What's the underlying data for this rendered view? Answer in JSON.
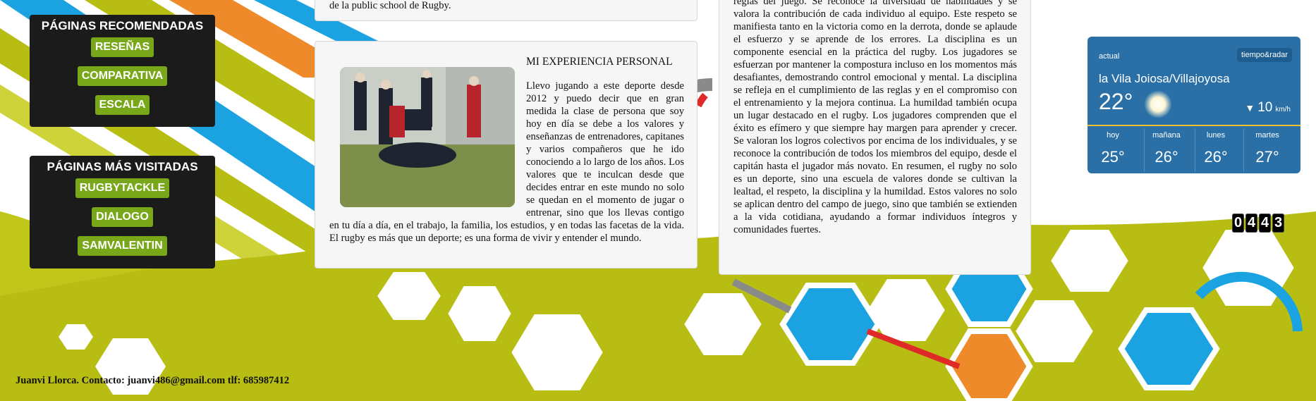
{
  "sidebar": {
    "recommended": {
      "title": "PÁGINAS RECOMENDADAS",
      "items": [
        "RESEÑAS",
        "COMPARATIVA",
        "ESCALA"
      ]
    },
    "most_visited": {
      "title": "PÁGINAS MÁS VISITADAS",
      "items": [
        "RUGBYTACKLE",
        "DIALOGO",
        "SAMVALENTIN"
      ]
    }
  },
  "top_card": {
    "text": "de la public school de Rugby."
  },
  "experience": {
    "title": "MI EXPERIENCIA PERSONAL",
    "photo_icon": "rugby-photo",
    "text": "Llevo jugando a este deporte desde 2012 y puedo decir que en gran medida la clase de persona que soy hoy en día se debe a los valores y enseñanzas de entrenadores, capitanes y varios compañeros que he ido conociendo a lo largo de los años. Los valores que te inculcan desde que decides entrar en este mundo no solo se quedan en el momento de jugar o entrenar, sino que los llevas contigo en tu día a día, en el trabajo, la familia, los estudios, y en todas las facetas de la vida. El rugby es más que un deporte; es una forma de vivir y entender el mundo."
  },
  "values": {
    "text": "reglas del juego. Se reconoce la diversidad de habilidades y se valora la contribución de cada individuo al equipo. Este respeto se manifiesta tanto en la victoria como en la derrota, donde se aplaude el esfuerzo y se aprende de los errores. La disciplina es un componente esencial en la práctica del rugby. Los jugadores se esfuerzan por mantener la compostura incluso en los momentos más desafiantes, demostrando control emocional y mental. La disciplina se refleja en el cumplimiento de las reglas y en el compromiso con el entrenamiento y la mejora continua. La humildad también ocupa un lugar destacado en el rugby. Los jugadores comprenden que el éxito es efímero y que siempre hay margen para aprender y crecer. Se valoran los logros colectivos por encima de los individuales, y se reconoce la contribución de todos los miembros del equipo, desde el capitán hasta el jugador más novato. En resumen, el rugby no solo es un deporte, sino una escuela de valores donde se cultivan la lealtad, el respeto, la disciplina y la humildad. Estos valores no solo se aplican dentro del campo de juego, sino que también se extienden a la vida cotidiana, ayudando a formar individuos íntegros y comunidades fuertes."
  },
  "weather": {
    "label": "actual",
    "brand": "tiempo&radar",
    "location": "la Vila Joiosa/Villajoyosa",
    "temp": "22°",
    "wind": "10",
    "wind_unit": "km/h",
    "forecast": [
      {
        "day": "hoy",
        "temp": "25°"
      },
      {
        "day": "mañana",
        "temp": "26°"
      },
      {
        "day": "lunes",
        "temp": "26°"
      },
      {
        "day": "martes",
        "temp": "27°"
      }
    ],
    "colors": {
      "panel": "#2a70a7",
      "accent": "#f2c230"
    }
  },
  "counter": {
    "digits": [
      "0",
      "4",
      "4",
      "3"
    ]
  },
  "footer": {
    "text": "Juanvi Llorca. Contacto: juanvi486@gmail.com tlf: 685987412"
  },
  "colors": {
    "lime": "#b8bd13",
    "orange": "#ef8a2a",
    "blue": "#1aa3e0",
    "button_green": "#78a719"
  }
}
